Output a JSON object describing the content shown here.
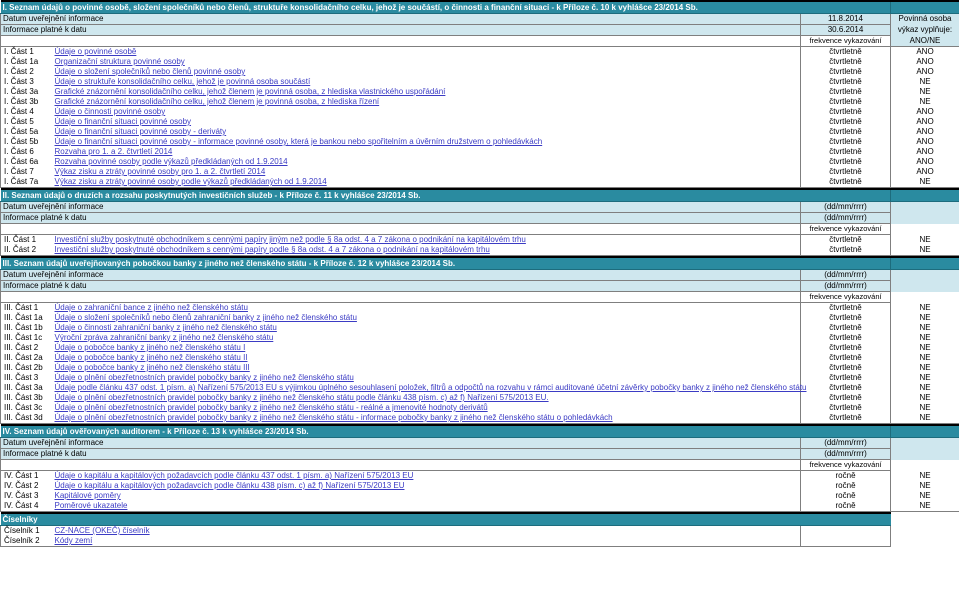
{
  "columns": {
    "freq_header": "frekvence vykazování",
    "side_line1": "Povinná osoba",
    "side_line2": "výkaz vyplňuje:",
    "side_line3": "ANO/NE"
  },
  "labels": {
    "datum": "Datum uveřejnění informace",
    "platne": "Informace platné k datu",
    "date_placeholder": "(dd/mm/rrrr)"
  },
  "sections": [
    {
      "id": "sec1",
      "band": "I. Seznam údajů o povinné osobě, složení společníků nebo členů, struktuře konsolidačního celku, jehož je součástí, o činnosti a finanční situaci - k Příloze č. 10 k vyhlášce 23/2014 Sb.",
      "datum_value": "11.8.2014",
      "platne_value": "30.6.2014",
      "rows": [
        {
          "code": "I. Část 1",
          "label": "Údaje o povinné osobě",
          "freq": "čtvrtletně",
          "ano": "ANO"
        },
        {
          "code": "I. Část 1a",
          "label": "Organizační struktura povinné osoby",
          "freq": "čtvrtletně",
          "ano": "ANO"
        },
        {
          "code": "I. Část 2",
          "label": "Údaje o složení společníků nebo členů povinné osoby",
          "freq": "čtvrtletně",
          "ano": "ANO"
        },
        {
          "code": "I. Část 3",
          "label": "Údaje o struktuře konsolidačního celku, jehož je povinná osoba součástí",
          "freq": "čtvrtletně",
          "ano": "NE"
        },
        {
          "code": "I. Část 3a",
          "label": "Grafické znázornění konsolidačního celku, jehož členem je povinná osoba, z hlediska vlastnického uspořádání",
          "freq": "čtvrtletně",
          "ano": "NE"
        },
        {
          "code": "I. Část 3b",
          "label": "Grafické znázornění konsolidačního celku, jehož členem je povinná osoba, z hlediska řízení",
          "freq": "čtvrtletně",
          "ano": "NE"
        },
        {
          "code": "I. Část 4",
          "label": "Údaje o činnosti povinné osoby",
          "freq": "čtvrtletně",
          "ano": "ANO"
        },
        {
          "code": "I. Část 5",
          "label": "Údaje o finanční situaci povinné osoby",
          "freq": "čtvrtletně",
          "ano": "ANO"
        },
        {
          "code": "I. Část 5a",
          "label": "Údaje o finanční situaci povinné osoby - deriváty",
          "freq": "čtvrtletně",
          "ano": "ANO"
        },
        {
          "code": "I. Část 5b",
          "label": "Údaje o finanční situaci povinné osoby - informace povinné osoby, která je bankou nebo spořitelním a úvěrním družstvem o pohledávkách",
          "freq": "čtvrtletně",
          "ano": "ANO"
        },
        {
          "code": "I. Část 6",
          "label": "Rozvaha pro 1. a 2. čtvrtletí 2014",
          "freq": "čtvrtletně",
          "ano": "ANO"
        },
        {
          "code": "I. Část 6a",
          "label": "Rozvaha povinné osoby podle výkazů předkládaných od 1.9.2014",
          "freq": "čtvrtletně",
          "ano": "ANO"
        },
        {
          "code": "I. Část 7",
          "label": "Výkaz zisku a ztráty povinné osoby pro 1. a 2. čtvrtletí 2014",
          "freq": "čtvrtletně",
          "ano": "ANO"
        },
        {
          "code": "I. Část 7a",
          "label": "Výkaz zisku a ztráty povinné osoby podle výkazů předkládaných od 1.9.2014",
          "freq": "čtvrtletně",
          "ano": "NE"
        }
      ]
    },
    {
      "id": "sec2",
      "band": "II. Seznam údajů o druzích a rozsahu poskytnutých investičních služeb - k Příloze č. 11 k vyhlášce 23/2014 Sb.",
      "datum_value": "(dd/mm/rrrr)",
      "platne_value": "(dd/mm/rrrr)",
      "rows": [
        {
          "code": "II. Část 1",
          "label": "Investiční služby poskytnuté obchodníkem s cennými papíry jiným než podle § 8a odst. 4 a 7 zákona o podnikání na kapitálovém trhu",
          "freq": "čtvrtletně",
          "ano": "NE"
        },
        {
          "code": "II. Část 2",
          "label": "Investiční služby poskytnuté obchodníkem s cennými papíry podle § 8a odst. 4 a 7 zákona o podnikání na kapitálovém trhu",
          "freq": "čtvrtletně",
          "ano": "NE"
        }
      ]
    },
    {
      "id": "sec3",
      "band": "III. Seznam údajů uveřejňovaných pobočkou banky z jiného než členského státu - k Příloze č. 12 k vyhlášce 23/2014 Sb.",
      "datum_value": "(dd/mm/rrrr)",
      "platne_value": "(dd/mm/rrrr)",
      "rows": [
        {
          "code": "III. Část 1",
          "label": "Údaje o zahraniční bance z jiného než členského státu",
          "freq": "čtvrtletně",
          "ano": "NE"
        },
        {
          "code": "III. Část 1a",
          "label": "Údaje o složení společníků nebo členů zahraniční banky z jiného než členského státu",
          "freq": "čtvrtletně",
          "ano": "NE"
        },
        {
          "code": "III. Část 1b",
          "label": "Údaje o činnosti zahraniční banky z jiného než členského státu",
          "freq": "čtvrtletně",
          "ano": "NE"
        },
        {
          "code": "III. Část 1c",
          "label": "Výroční zpráva zahraniční banky z jiného než členského státu",
          "freq": "čtvrtletně",
          "ano": "NE"
        },
        {
          "code": "III. Část 2",
          "label": "Údaje o pobočce banky z jiného než členského státu I",
          "freq": "čtvrtletně",
          "ano": "NE"
        },
        {
          "code": "III. Část 2a",
          "label": "Údaje o pobočce banky z jiného než členského státu II",
          "freq": "čtvrtletně",
          "ano": "NE"
        },
        {
          "code": "III. Část 2b",
          "label": "Údaje o pobočce banky z jiného než členského státu III",
          "freq": "čtvrtletně",
          "ano": "NE"
        },
        {
          "code": "III. Část 3",
          "label": "Údaje o plnění obezřetnostních pravidel pobočky banky z jiného než členského státu",
          "freq": "čtvrtletně",
          "ano": "NE"
        },
        {
          "code": "III. Část 3a",
          "label": "Údaje podle článku 437 odst. 1 písm. a) Nařízení 575/2013 EU s výjimkou úplného sesouhlasení položek, filtrů a odpočtů na rozvahu v rámci auditované účetní závěrky pobočky banky z jiného než členského státu",
          "freq": "čtvrtletně",
          "ano": "NE"
        },
        {
          "code": "III. Část 3b",
          "label": "Údaje o plnění obezřetnostních pravidel pobočky banky z jiného než členského státu podle článku 438 písm. c) až f) Nařízení 575/2013 EU.",
          "freq": "čtvrtletně",
          "ano": "NE"
        },
        {
          "code": "III. Část 3c",
          "label": "Údaje o plnění obezřetnostních pravidel pobočky banky z jiného než členského státu - reálné a jmenovité hodnoty derivátů",
          "freq": "čtvrtletně",
          "ano": "NE"
        },
        {
          "code": "III. Část 3d",
          "label": "Údaje o plnění obezřetnostních pravidel pobočky banky z jiného než členského státu - informace pobočky banky z jiného než členského státu o pohledávkách",
          "freq": "čtvrtletně",
          "ano": "NE"
        }
      ]
    },
    {
      "id": "sec4",
      "band": "IV. Seznam údajů ověřovaných auditorem - k Příloze č. 13 k vyhlášce 23/2014 Sb.",
      "datum_value": "(dd/mm/rrrr)",
      "platne_value": "(dd/mm/rrrr)",
      "rows": [
        {
          "code": "IV. Část 1",
          "label": "Údaje o kapitálu a kapitálových požadavcích podle článku 437 odst. 1 písm. a) Nařízení 575/2013 EU",
          "freq": "ročně",
          "ano": "NE"
        },
        {
          "code": "IV. Část 2",
          "label": "Údaje o kapitálu a kapitálových požadavcích podle článku 438 písm. c) až f) Nařízení 575/2013 EU",
          "freq": "ročně",
          "ano": "NE"
        },
        {
          "code": "IV. Část 3",
          "label": "Kapitálové poměry",
          "freq": "ročně",
          "ano": "NE"
        },
        {
          "code": "IV. Část 4",
          "label": "Poměrové ukazatele",
          "freq": "ročně",
          "ano": "NE"
        }
      ]
    }
  ],
  "ciselniky": {
    "band": "Číselníky",
    "rows": [
      {
        "code": "Číselník 1",
        "label": "CZ-NACE (OKEČ) číselník"
      },
      {
        "code": "Číselník 2",
        "label": "Kódy zemí"
      }
    ]
  }
}
